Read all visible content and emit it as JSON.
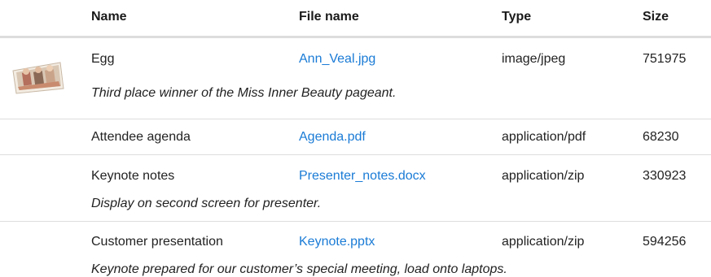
{
  "columns": {
    "name": "Name",
    "file_name": "File name",
    "type": "Type",
    "size": "Size"
  },
  "rows": [
    {
      "name": "Egg",
      "file_name": "Ann_Veal.jpg",
      "type": "image/jpeg",
      "size": "751975",
      "description": "Third place winner of the Miss Inner Beauty pageant.",
      "has_thumbnail": true
    },
    {
      "name": "Attendee agenda",
      "file_name": "Agenda.pdf",
      "type": "application/pdf",
      "size": "68230",
      "description": ""
    },
    {
      "name": "Keynote notes",
      "file_name": "Presenter_notes.docx",
      "type": "application/zip",
      "size": "330923",
      "description": "Display on second screen for presenter."
    },
    {
      "name": "Customer presentation",
      "file_name": "Keynote.pptx",
      "type": "application/zip",
      "size": "594256",
      "description": "Keynote prepared for our customer’s special meeting, load onto laptops."
    }
  ],
  "colors": {
    "link": "#1a7bd6",
    "divider": "#dddddd",
    "text": "#222222"
  }
}
